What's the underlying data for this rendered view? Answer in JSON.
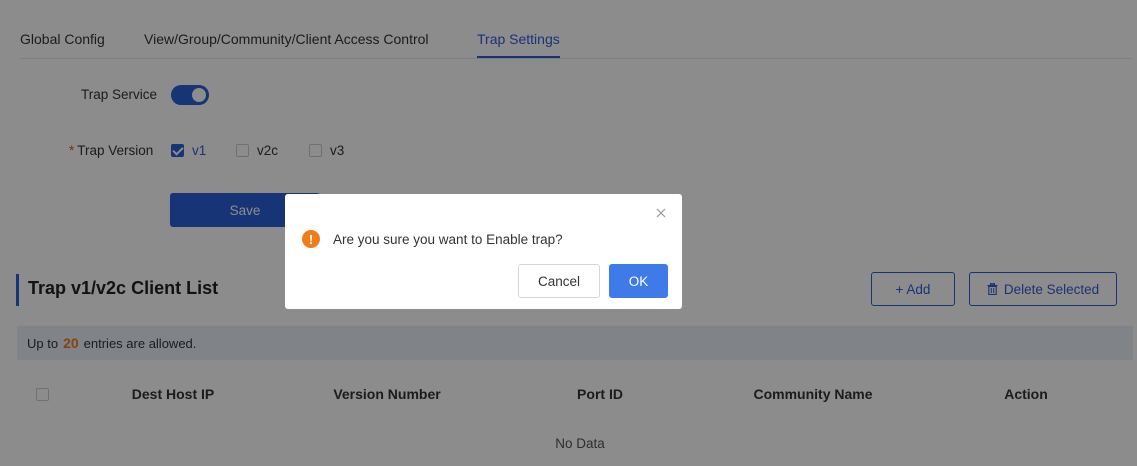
{
  "tabs": [
    {
      "label": "Global Config"
    },
    {
      "label": "View/Group/Community/Client Access Control"
    },
    {
      "label": "Trap Settings"
    }
  ],
  "form": {
    "trap_service_label": "Trap Service",
    "trap_service_enabled": true,
    "required_mark": "*",
    "trap_version_label": "Trap Version",
    "versions": [
      {
        "label": "v1",
        "checked": true
      },
      {
        "label": "v2c",
        "checked": false
      },
      {
        "label": "v3",
        "checked": false
      }
    ],
    "save_label": "Save"
  },
  "client_list": {
    "title": "Trap v1/v2c Client List",
    "add_label": "+ Add",
    "delete_label": "Delete Selected",
    "info_prefix": "Up to",
    "info_count": "20",
    "info_suffix": "entries are allowed.",
    "columns": [
      "Dest Host IP",
      "Version Number",
      "Port ID",
      "Community Name",
      "Action"
    ],
    "empty_text": "No Data"
  },
  "dialog": {
    "message": "Are you sure you want to Enable trap?",
    "warn_glyph": "!",
    "cancel_label": "Cancel",
    "ok_label": "OK"
  },
  "colors": {
    "accent": "#2b5fd9",
    "warning": "#f07c1a",
    "overlay": "rgba(0,0,0,0.45)"
  }
}
